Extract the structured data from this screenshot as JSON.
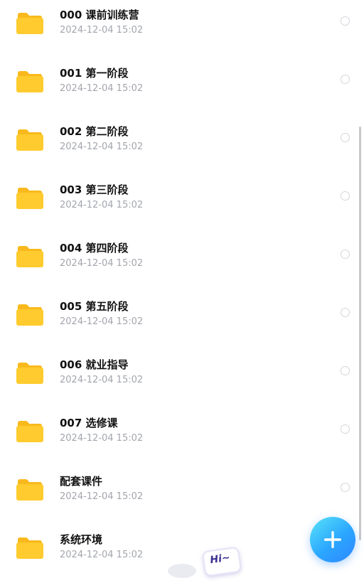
{
  "files": [
    {
      "name": "000 课前训练营",
      "date": "2024-12-04 15:02",
      "icon": "folder-icon"
    },
    {
      "name": "001 第一阶段",
      "date": "2024-12-04 15:02",
      "icon": "folder-icon"
    },
    {
      "name": "002 第二阶段",
      "date": "2024-12-04 15:02",
      "icon": "folder-icon"
    },
    {
      "name": "003 第三阶段",
      "date": "2024-12-04 15:02",
      "icon": "folder-icon"
    },
    {
      "name": "004 第四阶段",
      "date": "2024-12-04 15:02",
      "icon": "folder-icon"
    },
    {
      "name": "005 第五阶段",
      "date": "2024-12-04 15:02",
      "icon": "folder-icon"
    },
    {
      "name": "006 就业指导",
      "date": "2024-12-04 15:02",
      "icon": "folder-icon"
    },
    {
      "name": "007 选修课",
      "date": "2024-12-04 15:02",
      "icon": "folder-icon"
    },
    {
      "name": "配套课件",
      "date": "2024-12-04 15:02",
      "icon": "folder-icon"
    },
    {
      "name": "系统环境",
      "date": "2024-12-04 15:02",
      "icon": "folder-icon"
    }
  ],
  "fab": {
    "icon": "plus-icon"
  },
  "mascot": {
    "label": "Hi~"
  },
  "colors": {
    "folder": "#FFCB2E",
    "folder_tab": "#F9B91C",
    "accent": "#2BA6FF",
    "date_text": "#A3A6AD"
  }
}
